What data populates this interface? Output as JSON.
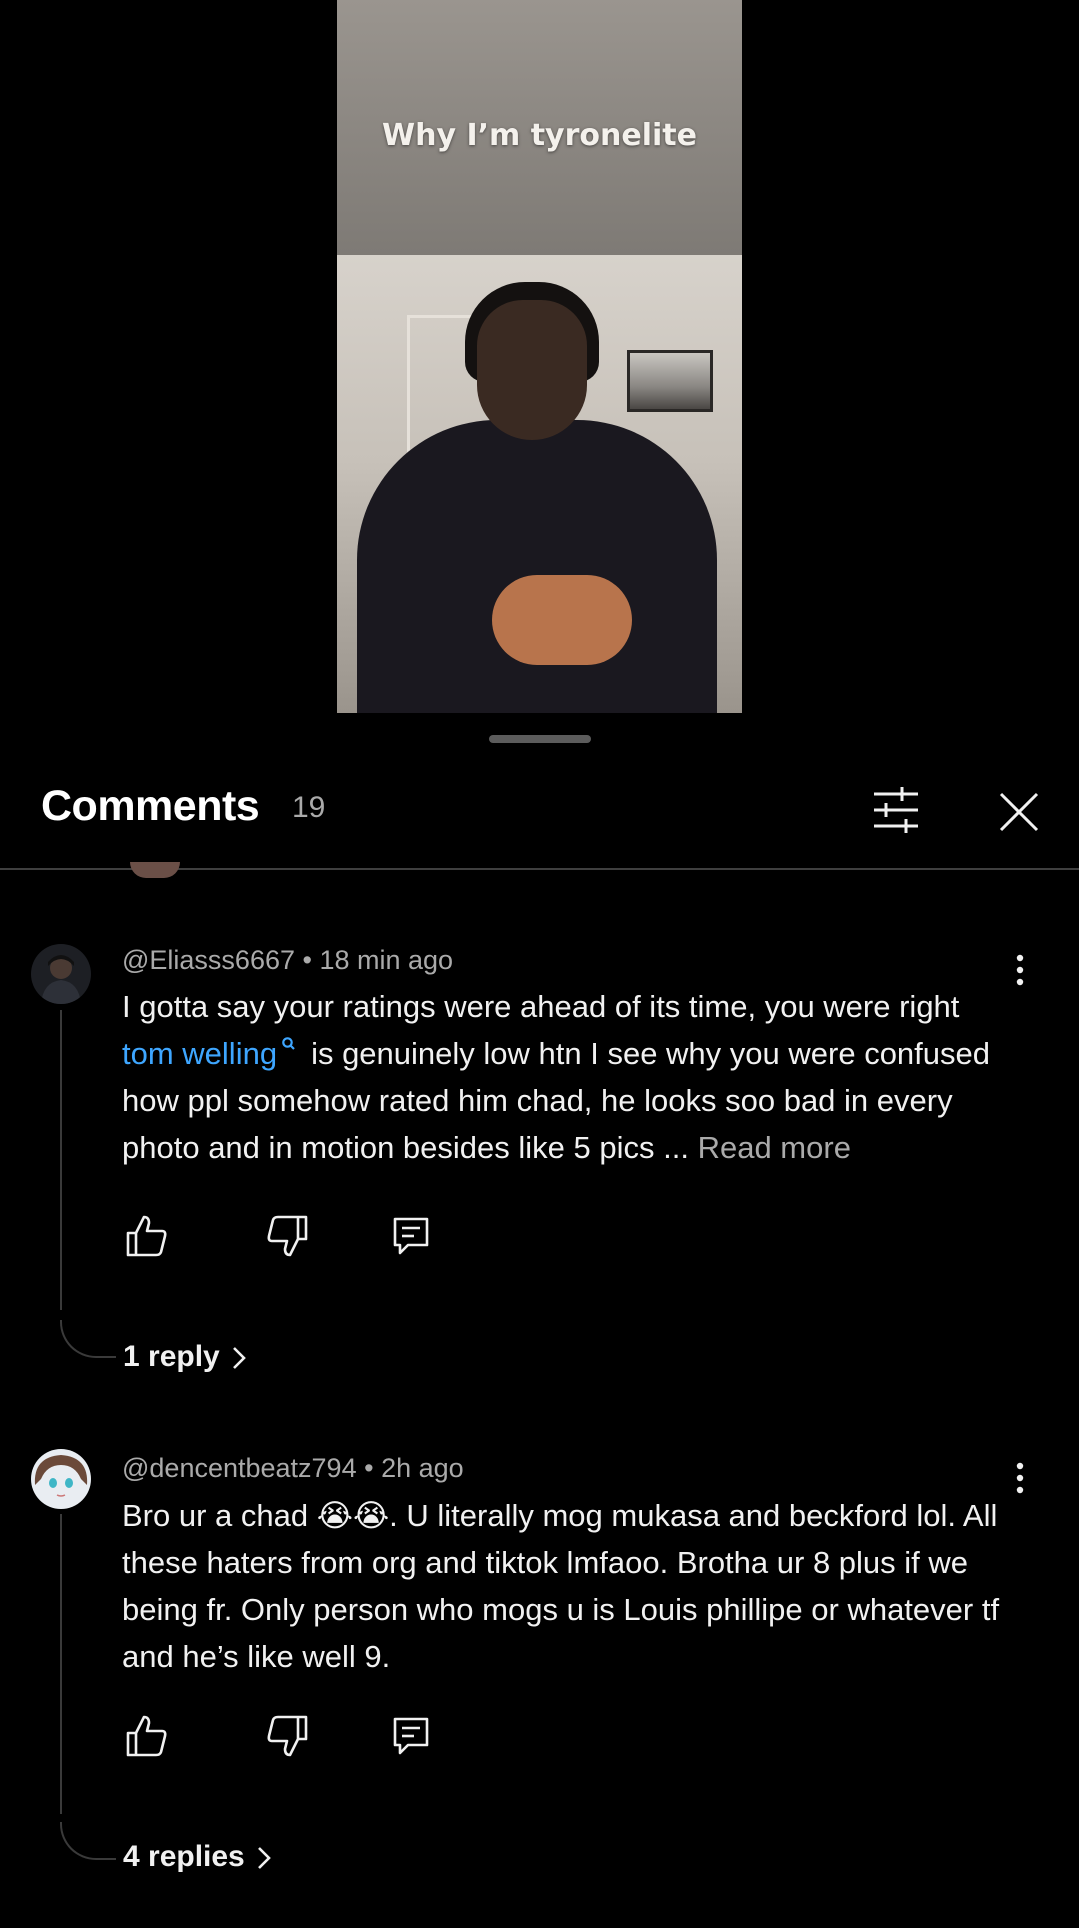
{
  "video": {
    "caption": "Why I’m tyronelite"
  },
  "comments_panel": {
    "title": "Comments",
    "count": "19",
    "icons": {
      "filter": "sliders-icon",
      "close": "close-icon",
      "more": "more-vertical-icon",
      "like": "thumbs-up-icon",
      "dislike": "thumbs-down-icon",
      "reply": "reply-icon",
      "chevron": "chevron-right-icon"
    }
  },
  "comments": [
    {
      "author": "@Eliasss6667",
      "time": "18 min ago",
      "text_before": "I gotta say your ratings were ahead of its time, you were  right",
      "mention": "tom welling",
      "text_after": "is genuinely low htn I see why you were confused how ppl somehow rated him chad, he looks soo bad in every photo and in motion besides like 5 pics ...",
      "read_more": "Read more",
      "replies": "1 reply"
    },
    {
      "author": "@dencentbeatz794",
      "time": "2h ago",
      "text": "Bro ur a chad 😭😭. U literally mog mukasa and beckford lol. All these haters from org and tiktok lmfaoo. Brotha ur 8 plus if we being fr. Only person who mogs u is Louis phillipe or whatever tf and he’s like well 9.",
      "replies": "4 replies"
    }
  ],
  "colors": {
    "background": "#000000",
    "link": "#3ea6ff",
    "secondary_text": "#aaaaaa",
    "divider": "#3f3f3f"
  }
}
